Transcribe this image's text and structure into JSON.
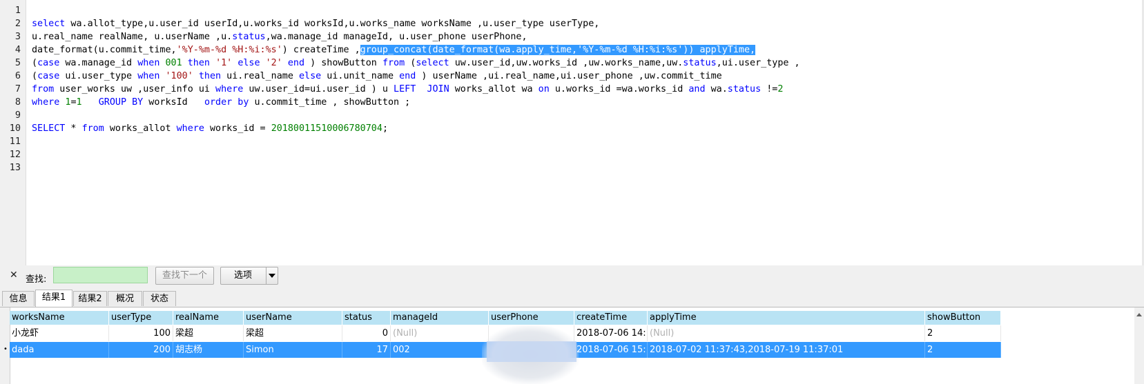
{
  "editor": {
    "line_numbers": [
      "1",
      "2",
      "3",
      "4",
      "5",
      "6",
      "7",
      "8",
      "9",
      "10",
      "11",
      "12",
      "13"
    ],
    "lines": [
      [],
      [
        [
          "kw",
          "select"
        ],
        [
          "p",
          " wa.allot_type,u.user_id userId,u.works_id worksId,u.works_name worksName ,u.user_type userType,"
        ]
      ],
      [
        [
          "p",
          "u.real_name realName, u.userName ,u."
        ],
        [
          "kw",
          "status"
        ],
        [
          "p",
          ",wa.manage_id manageId, u.user_phone userPhone,"
        ]
      ],
      [
        [
          "p",
          "date_format(u.commit_time,"
        ],
        [
          "str",
          "'%Y-%m-%d %H:%i:%s'"
        ],
        [
          "p",
          ") createTime ,"
        ],
        [
          "sel",
          "group_concat(date_format(wa.apply_time,'%Y-%m-%d %H:%i:%s')) applyTime,"
        ]
      ],
      [
        [
          "p",
          "("
        ],
        [
          "kw",
          "case"
        ],
        [
          "p",
          " wa.manage_id "
        ],
        [
          "kw",
          "when"
        ],
        [
          "p",
          " "
        ],
        [
          "num",
          "001"
        ],
        [
          "p",
          " "
        ],
        [
          "kw",
          "then"
        ],
        [
          "p",
          " "
        ],
        [
          "str",
          "'1'"
        ],
        [
          "p",
          " "
        ],
        [
          "kw",
          "else"
        ],
        [
          "p",
          " "
        ],
        [
          "str",
          "'2'"
        ],
        [
          "p",
          " "
        ],
        [
          "kw",
          "end"
        ],
        [
          "p",
          " ) showButton "
        ],
        [
          "kw",
          "from"
        ],
        [
          "p",
          " ("
        ],
        [
          "kw",
          "select"
        ],
        [
          "p",
          " uw.user_id,uw.works_id ,uw.works_name,uw."
        ],
        [
          "kw",
          "status"
        ],
        [
          "p",
          ",ui.user_type ,"
        ]
      ],
      [
        [
          "p",
          "("
        ],
        [
          "kw",
          "case"
        ],
        [
          "p",
          " ui.user_type "
        ],
        [
          "kw",
          "when"
        ],
        [
          "p",
          " "
        ],
        [
          "str",
          "'100'"
        ],
        [
          "p",
          " "
        ],
        [
          "kw",
          "then"
        ],
        [
          "p",
          " ui.real_name "
        ],
        [
          "kw",
          "else"
        ],
        [
          "p",
          " ui.unit_name "
        ],
        [
          "kw",
          "end"
        ],
        [
          "p",
          " ) userName ,ui.real_name,ui.user_phone ,uw.commit_time"
        ]
      ],
      [
        [
          "kw",
          "from"
        ],
        [
          "p",
          " user_works uw ,user_info ui "
        ],
        [
          "kw",
          "where"
        ],
        [
          "p",
          " uw.user_id=ui.user_id ) u "
        ],
        [
          "kw",
          "LEFT"
        ],
        [
          "p",
          "  "
        ],
        [
          "kw",
          "JOIN"
        ],
        [
          "p",
          " works_allot wa "
        ],
        [
          "kw",
          "on"
        ],
        [
          "p",
          " u.works_id =wa.works_id "
        ],
        [
          "kw",
          "and"
        ],
        [
          "p",
          " wa."
        ],
        [
          "kw",
          "status"
        ],
        [
          "p",
          " !="
        ],
        [
          "num",
          "2"
        ]
      ],
      [
        [
          "kw",
          "where"
        ],
        [
          "p",
          " "
        ],
        [
          "num",
          "1"
        ],
        [
          "p",
          "="
        ],
        [
          "num",
          "1"
        ],
        [
          "p",
          "   "
        ],
        [
          "kw",
          "GROUP BY"
        ],
        [
          "p",
          " worksId   "
        ],
        [
          "kw",
          "order by"
        ],
        [
          "p",
          " u.commit_time , showButton ;"
        ]
      ],
      [],
      [
        [
          "kw",
          "SELECT"
        ],
        [
          "p",
          " * "
        ],
        [
          "kw",
          "from"
        ],
        [
          "p",
          " works_allot "
        ],
        [
          "kw",
          "where"
        ],
        [
          "p",
          " works_id = "
        ],
        [
          "num",
          "20180011510006780704"
        ],
        [
          "p",
          ";"
        ]
      ],
      [],
      [],
      []
    ]
  },
  "findbar": {
    "close_icon": "close-icon",
    "label": "查找:",
    "input_value": "",
    "find_next_label": "查找下一个",
    "options_label": "选项"
  },
  "tabs": [
    {
      "label": "信息",
      "active": false
    },
    {
      "label": "结果1",
      "active": true
    },
    {
      "label": "结果2",
      "active": false
    },
    {
      "label": "概况",
      "active": false
    },
    {
      "label": "状态",
      "active": false
    }
  ],
  "grid": {
    "columns": [
      "worksName",
      "userType",
      "realName",
      "userName",
      "status",
      "manageId",
      "userPhone",
      "createTime",
      "applyTime",
      "showButton"
    ],
    "rows": [
      [
        "小龙虾",
        "100",
        "梁超",
        "梁超",
        "0",
        "(Null)",
        "",
        "2018-07-06 14:",
        "(Null)",
        "2"
      ],
      [
        "dada",
        "200",
        "胡志杨",
        "Simon",
        "17",
        "002",
        "",
        "2018-07-06 15:",
        "2018-07-02 11:37:43,2018-07-19 11:37:01",
        "2"
      ]
    ],
    "selected_row": 1,
    "row_marker": "•"
  },
  "colors": {
    "keyword": "#0000ff",
    "string": "#a31515",
    "number": "#008000",
    "selection": "#3399ff",
    "header_bg": "#b9e3f4",
    "find_input_bg": "#c8f0c8"
  }
}
